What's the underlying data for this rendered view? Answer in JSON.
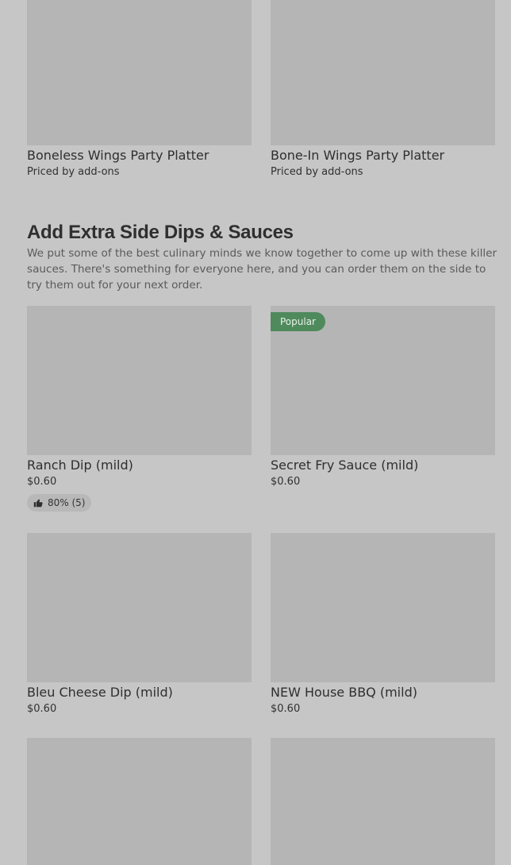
{
  "top_items": [
    {
      "name": "Boneless Wings Party Platter",
      "price": "Priced by add-ons"
    },
    {
      "name": "Bone-In Wings Party Platter",
      "price": "Priced by add-ons"
    }
  ],
  "section": {
    "title": "Add Extra Side Dips & Sauces",
    "description": "We put some of the best culinary minds we know together to come up with these killer sauces. There's something for everyone here, and you can order them on the side to try them out for your next order."
  },
  "items": [
    {
      "name": "Ranch Dip (mild)",
      "price": "$0.60",
      "rating": "80% (5)"
    },
    {
      "name": "Secret Fry Sauce (mild)",
      "price": "$0.60",
      "badge": "Popular"
    },
    {
      "name": "Bleu Cheese Dip (mild)",
      "price": "$0.60"
    },
    {
      "name": "NEW House BBQ (mild)",
      "price": "$0.60"
    }
  ],
  "colors": {
    "background": "#c6c6c6",
    "image_placeholder": "#b5b5b5",
    "popular_badge": "#4f8a5c"
  }
}
